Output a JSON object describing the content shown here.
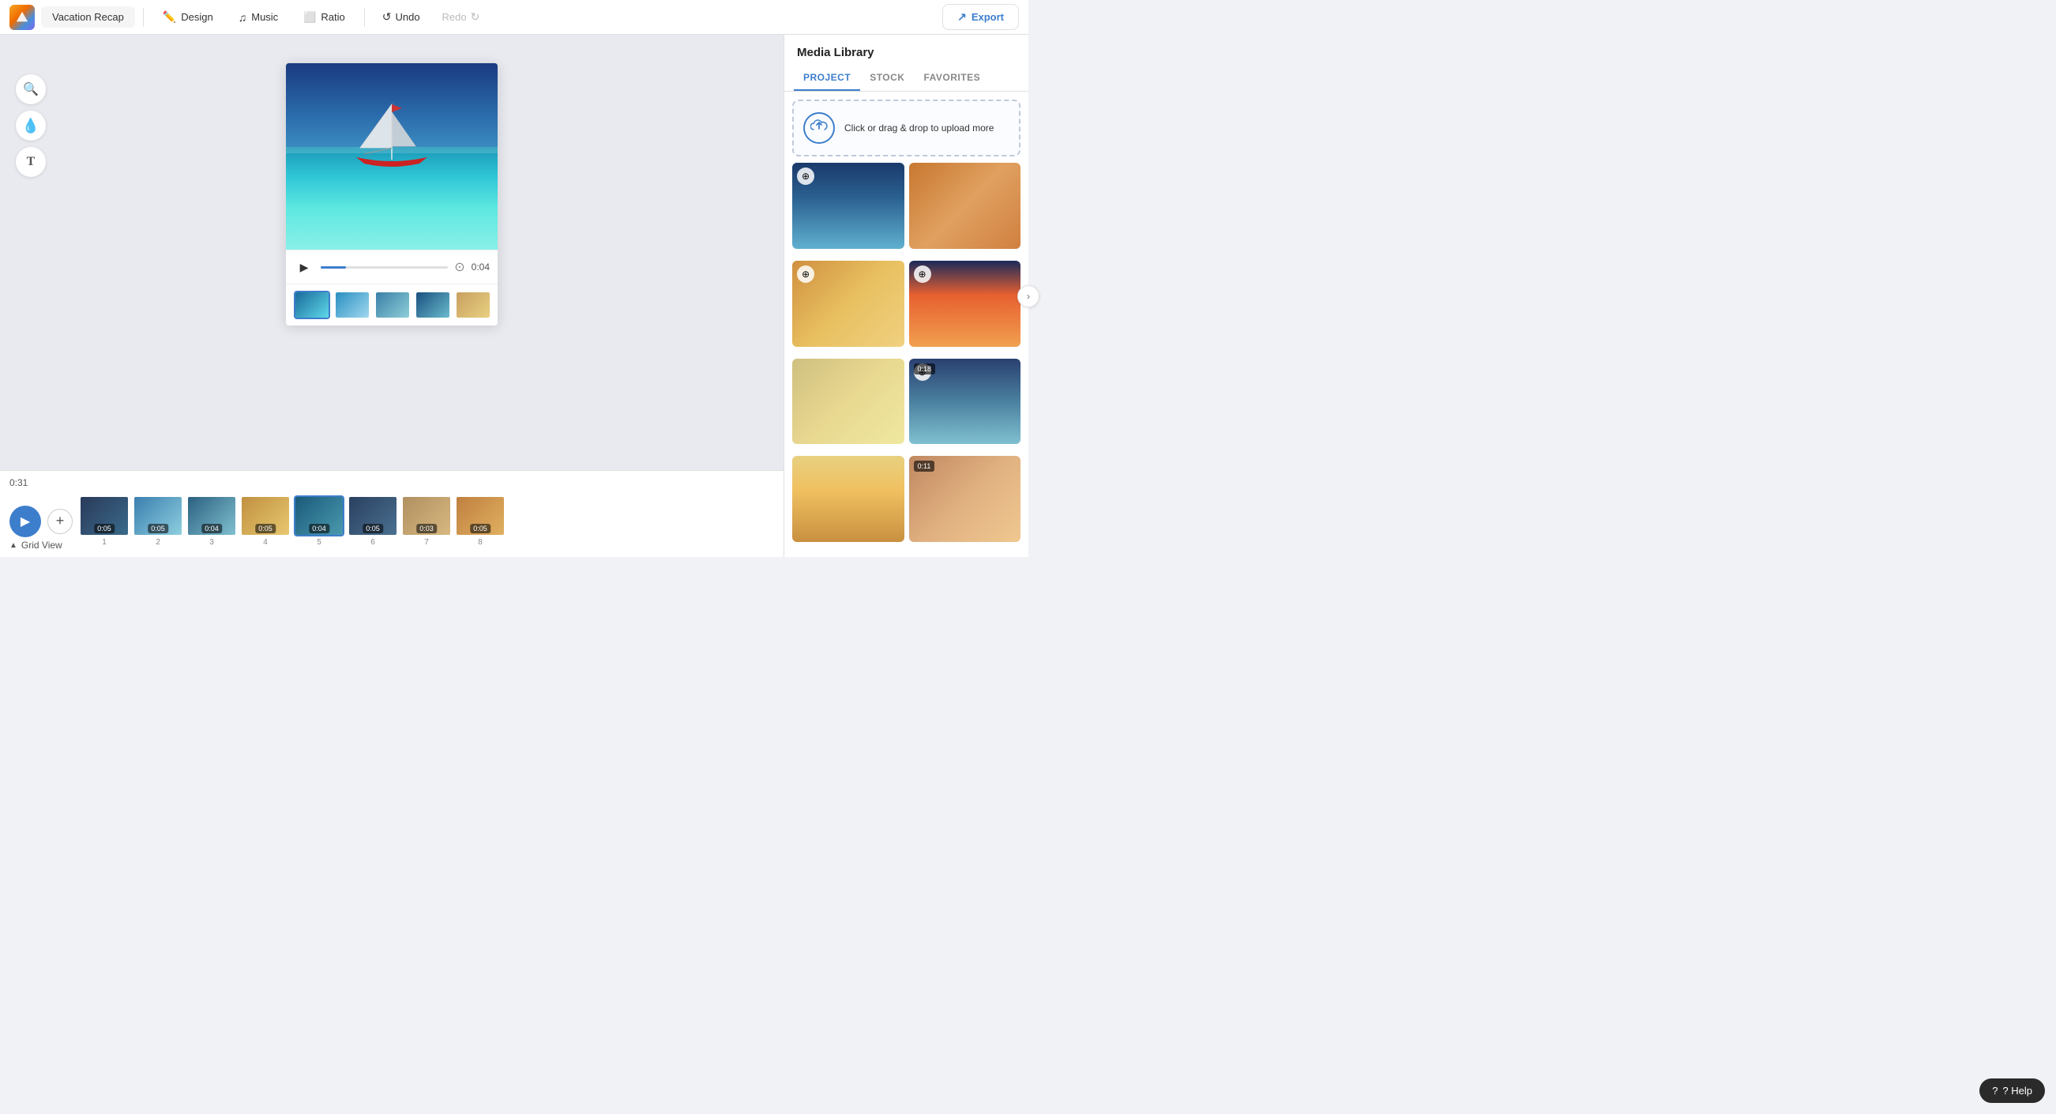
{
  "app": {
    "logo_alt": "Animoto logo"
  },
  "toolbar": {
    "project_name": "Vacation Recap",
    "tabs": [
      {
        "id": "design",
        "label": "Design",
        "icon": "✏️"
      },
      {
        "id": "music",
        "label": "Music",
        "icon": "♪"
      },
      {
        "id": "ratio",
        "label": "Ratio",
        "icon": "▣"
      }
    ],
    "undo_label": "Undo",
    "redo_label": "Redo",
    "export_label": "Export"
  },
  "tools": [
    {
      "id": "search",
      "icon": "🔍",
      "label": "search-tool"
    },
    {
      "id": "drop",
      "icon": "◎",
      "label": "drop-tool"
    },
    {
      "id": "text",
      "icon": "T",
      "label": "text-tool"
    }
  ],
  "canvas": {
    "duration": "0:04",
    "filmstrip": [
      {
        "id": 1,
        "active": true,
        "color_class": "ft1"
      },
      {
        "id": 2,
        "active": false,
        "color_class": "ft2"
      },
      {
        "id": 3,
        "active": false,
        "color_class": "ft3"
      },
      {
        "id": 4,
        "active": false,
        "color_class": "ft4"
      },
      {
        "id": 5,
        "active": false,
        "color_class": "ft5"
      }
    ]
  },
  "timeline": {
    "current_time": "0:31",
    "grid_view_label": "Grid View",
    "clips": [
      {
        "number": "1",
        "duration": "0:05",
        "color": "linear-gradient(135deg,#2a3a5a,#3a6a8a)"
      },
      {
        "number": "2",
        "duration": "0:05",
        "color": "linear-gradient(135deg,#3a7faf,#8ecfdf)"
      },
      {
        "number": "3",
        "duration": "0:04",
        "color": "linear-gradient(135deg,#2a6080,#80c0d0)"
      },
      {
        "number": "4",
        "duration": "0:05",
        "color": "linear-gradient(135deg,#c09040,#e8c870)"
      },
      {
        "number": "5",
        "duration": "0:04",
        "color": "linear-gradient(135deg,#1a5a7a,#4a9aaf)",
        "selected": true
      },
      {
        "number": "6",
        "duration": "0:05",
        "color": "linear-gradient(135deg,#2a4060,#4a7090)"
      },
      {
        "number": "7",
        "duration": "0:03",
        "color": "linear-gradient(135deg,#b09060,#d8b880)"
      },
      {
        "number": "8",
        "duration": "0:05",
        "color": "linear-gradient(135deg,#c08040,#e0b060)"
      }
    ]
  },
  "media_library": {
    "title": "Media Library",
    "tabs": [
      {
        "id": "project",
        "label": "PROJECT",
        "active": true
      },
      {
        "id": "stock",
        "label": "STOCK",
        "active": false
      },
      {
        "id": "favorites",
        "label": "FAVORITES",
        "active": false
      }
    ],
    "upload": {
      "text": "Click or drag & drop to upload more",
      "icon": "☁"
    },
    "items": [
      {
        "id": 1,
        "type": "photo",
        "color": "linear-gradient(180deg,#1a3a6b 0%,#2a6090 40%,#60b0d0 100%)",
        "has_zoom": true
      },
      {
        "id": 2,
        "type": "photo",
        "color": "linear-gradient(135deg,#c87830 0%,#e0a060 50%,#d08040 100%)",
        "has_zoom": false
      },
      {
        "id": 3,
        "type": "photo",
        "color": "linear-gradient(135deg,#d09040 0%,#e8c060 50%,#f0d080 100%)",
        "has_zoom": true
      },
      {
        "id": 4,
        "type": "photo",
        "color": "linear-gradient(180deg,#1a2a5a 0%,#e86030 40%,#f0a050 100%)",
        "has_zoom": true
      },
      {
        "id": 5,
        "type": "photo",
        "color": "linear-gradient(135deg,#d0c080 0%,#e8d890 50%,#f0e8a0 100%)",
        "has_zoom": false
      },
      {
        "id": 6,
        "type": "video",
        "duration": "0:18",
        "color": "linear-gradient(180deg,#2a4070 0%,#4a80a0 50%,#80c0d0 100%)",
        "has_zoom": true
      },
      {
        "id": 7,
        "type": "photo",
        "color": "linear-gradient(180deg,#e8d080 0%,#f0c060 40%,#c89040 100%)",
        "has_zoom": false
      },
      {
        "id": 8,
        "type": "video",
        "duration": "0:11",
        "color": "linear-gradient(135deg,#c08860 0%,#e0b080 50%,#f0c890 100%)",
        "has_zoom": false
      }
    ]
  },
  "help_label": "? Help"
}
